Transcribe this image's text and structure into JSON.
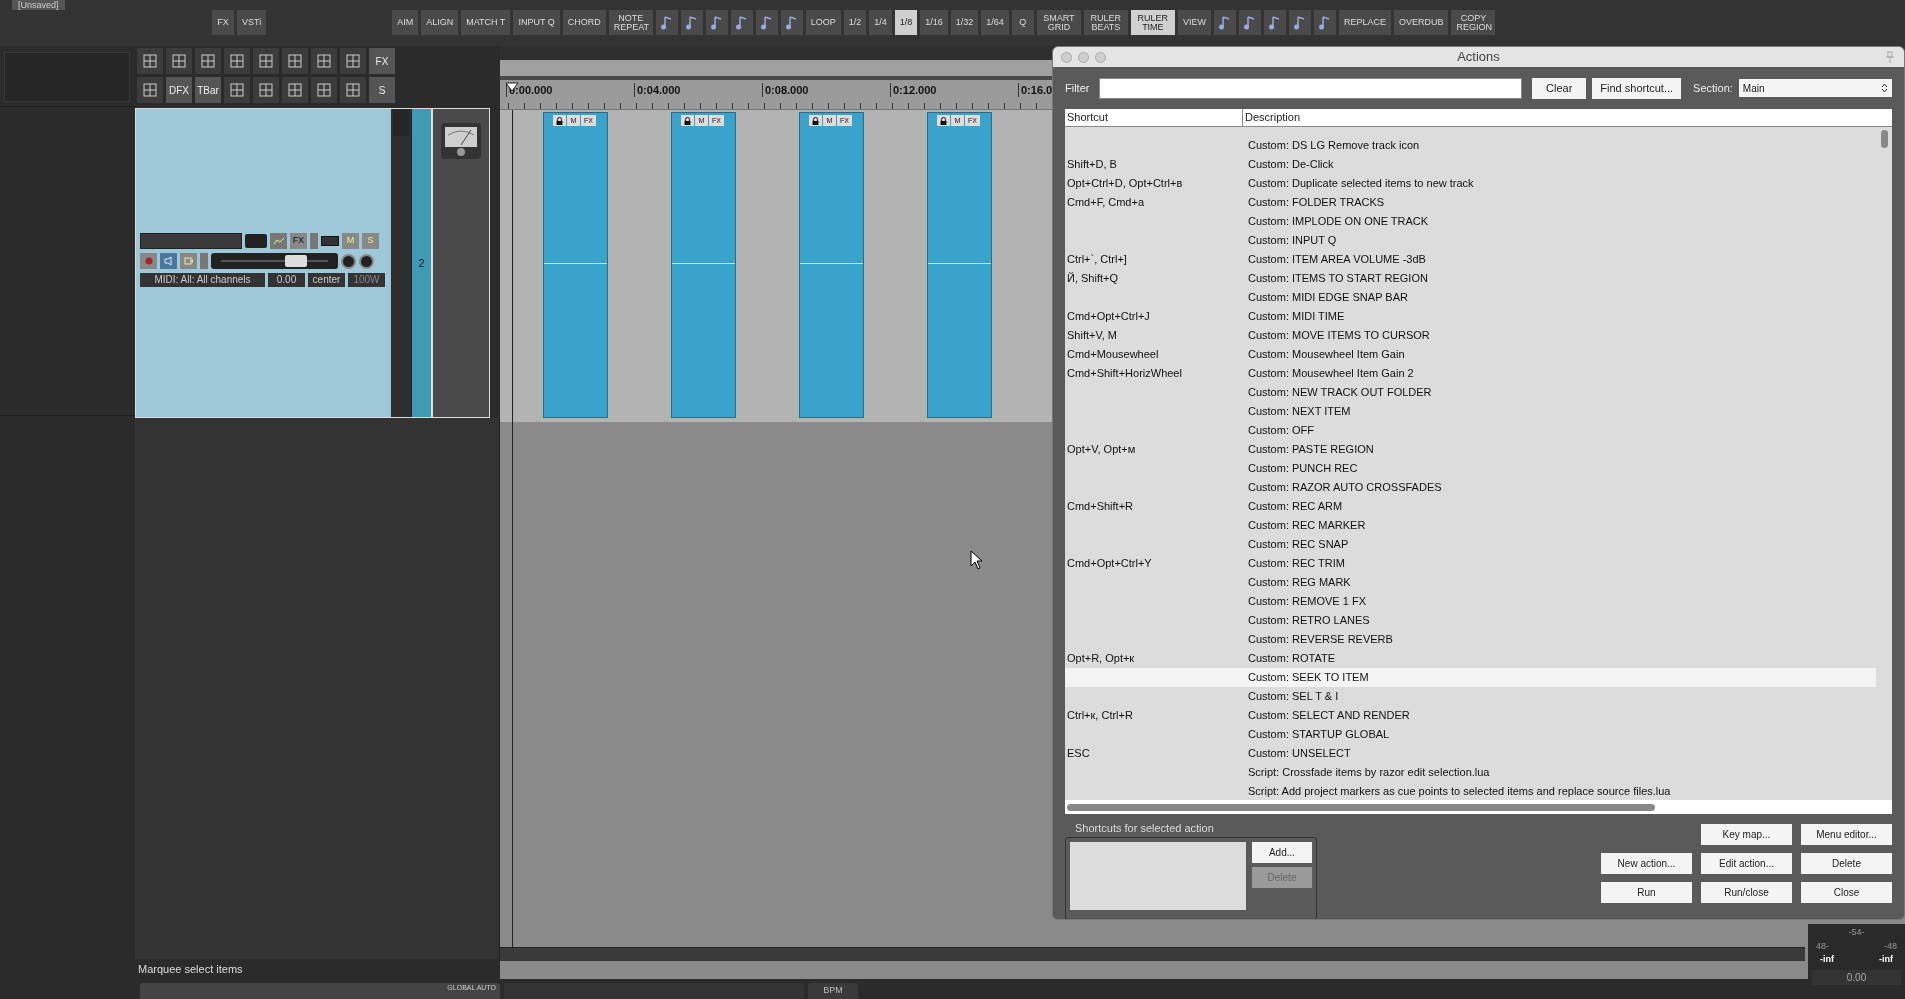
{
  "window": {
    "title": "[Unsaved]"
  },
  "toolbar": [
    {
      "kind": "text",
      "label": "FX",
      "selected": false
    },
    {
      "kind": "text",
      "label": "VSTi",
      "selected": false
    },
    {
      "kind": "gap"
    },
    {
      "kind": "text",
      "label": "AIM",
      "selected": false
    },
    {
      "kind": "text",
      "label": "ALIGN",
      "selected": false
    },
    {
      "kind": "text",
      "label": "MATCH T",
      "selected": false
    },
    {
      "kind": "text",
      "label": "INPUT Q",
      "selected": false
    },
    {
      "kind": "text",
      "label": "CHORD",
      "selected": false
    },
    {
      "kind": "text",
      "label": "NOTE REPEAT",
      "selected": false
    },
    {
      "kind": "icon"
    },
    {
      "kind": "icon"
    },
    {
      "kind": "icon"
    },
    {
      "kind": "icon"
    },
    {
      "kind": "icon"
    },
    {
      "kind": "icon"
    },
    {
      "kind": "text",
      "label": "LOOP",
      "selected": false
    },
    {
      "kind": "text",
      "label": "1/2",
      "selected": false
    },
    {
      "kind": "text",
      "label": "1/4",
      "selected": false
    },
    {
      "kind": "text",
      "label": "1/8",
      "selected": true
    },
    {
      "kind": "text",
      "label": "1/16",
      "selected": false
    },
    {
      "kind": "text",
      "label": "1/32",
      "selected": false
    },
    {
      "kind": "text",
      "label": "1/64",
      "selected": false
    },
    {
      "kind": "text",
      "label": "Q",
      "selected": false
    },
    {
      "kind": "text",
      "label": "SMART GRID",
      "selected": false
    },
    {
      "kind": "text",
      "label": "RULER BEATS",
      "selected": false
    },
    {
      "kind": "text",
      "label": "RULER TIME",
      "selected": true
    },
    {
      "kind": "text",
      "label": "VIEW",
      "selected": false
    },
    {
      "kind": "icon"
    },
    {
      "kind": "icon"
    },
    {
      "kind": "icon"
    },
    {
      "kind": "icon"
    },
    {
      "kind": "icon"
    },
    {
      "kind": "text",
      "label": "REPLACE",
      "selected": false
    },
    {
      "kind": "text",
      "label": "OVERDUB",
      "selected": false
    },
    {
      "kind": "text",
      "label": "COPY REGION",
      "selected": false
    }
  ],
  "palette": [
    [
      {
        "kind": "icon"
      },
      {
        "kind": "icon"
      },
      {
        "kind": "icon"
      },
      {
        "kind": "icon"
      },
      {
        "kind": "icon"
      },
      {
        "kind": "icon"
      },
      {
        "kind": "icon"
      },
      {
        "kind": "icon"
      },
      {
        "kind": "text",
        "label": "FX"
      }
    ],
    [
      {
        "kind": "icon"
      },
      {
        "kind": "text",
        "label": "DFX"
      },
      {
        "kind": "text",
        "label": "TBar"
      },
      {
        "kind": "icon"
      },
      {
        "kind": "icon"
      },
      {
        "kind": "icon"
      },
      {
        "kind": "icon"
      },
      {
        "kind": "icon"
      },
      {
        "kind": "text",
        "label": "S"
      }
    ]
  ],
  "track": {
    "number": "2",
    "fx": "FX",
    "mute": "M",
    "solo": "S",
    "input": "MIDI: All: All channels",
    "volume": "0.00",
    "pan": "center",
    "width": "100W",
    "fader": {
      "level": 0.7
    },
    "fx_bypass": {
      "on": true
    }
  },
  "ruler": {
    "labels": [
      "0:00.000",
      "0:04.000",
      "0:08.000",
      "0:12.000",
      "0:16.0"
    ]
  },
  "items": [
    {
      "lock": "M",
      "fx": "FX"
    },
    {
      "lock": "M",
      "fx": "FX"
    },
    {
      "lock": "M",
      "fx": "FX"
    },
    {
      "lock": "M",
      "fx": "FX"
    }
  ],
  "status_bar": {
    "text": "Marquee select items"
  },
  "transport": {
    "global_auto": "GLOBAL AUTO",
    "bpm": "BPM"
  },
  "meter": {
    "scale": [
      "-54-",
      "48-",
      "-48"
    ],
    "left": "-inf",
    "right": "-inf",
    "volume": "0.00"
  },
  "actions": {
    "title": "Actions",
    "filter_label": "Filter",
    "clear": "Clear",
    "find": "Find shortcut...",
    "section_label": "Section:",
    "section": "Main",
    "columns": [
      "Shortcut",
      "Description"
    ],
    "rows": [
      {
        "description": "Custom: DS LG Remove track icon",
        "selected": false
      },
      {
        "shortcut": "Shift+D, B",
        "description": "Custom: De-Click",
        "selected": false
      },
      {
        "shortcut": "Opt+Ctrl+D, Opt+Ctrl+в",
        "description": "Custom: Duplicate selected items to new track",
        "selected": false
      },
      {
        "shortcut": "Cmd+F, Cmd+a",
        "description": "Custom: FOLDER TRACKS",
        "selected": false
      },
      {
        "description": "Custom: IMPLODE ON ONE TRACK",
        "selected": false
      },
      {
        "description": "Custom: INPUT Q",
        "selected": false
      },
      {
        "shortcut": "Ctrl+`, Ctrl+]",
        "description": "Custom: ITEM AREA VOLUME -3dB",
        "selected": false
      },
      {
        "shortcut": "Й, Shift+Q",
        "description": "Custom: ITEMS TO START REGION",
        "selected": false
      },
      {
        "description": "Custom: MIDI EDGE SNAP BAR",
        "selected": false
      },
      {
        "shortcut": "Cmd+Opt+Ctrl+J",
        "description": "Custom: MIDI TIME",
        "selected": false
      },
      {
        "shortcut": "Shift+V, M",
        "description": "Custom: MOVE ITEMS TO CURSOR",
        "selected": false
      },
      {
        "shortcut": "Cmd+Mousewheel",
        "description": "Custom: Mousewheel Item Gain",
        "selected": false
      },
      {
        "shortcut": "Cmd+Shift+HorizWheel",
        "description": "Custom: Mousewheel Item Gain 2",
        "selected": false
      },
      {
        "description": "Custom: NEW TRACK OUT FOLDER",
        "selected": false
      },
      {
        "description": "Custom: NEXT ITEM",
        "selected": false
      },
      {
        "description": "Custom: OFF",
        "selected": false
      },
      {
        "shortcut": "Opt+V, Opt+м",
        "description": "Custom: PASTE REGION",
        "selected": false
      },
      {
        "description": "Custom: PUNCH REC",
        "selected": false
      },
      {
        "description": "Custom: RAZOR AUTO CROSSFADES",
        "selected": false
      },
      {
        "shortcut": "Cmd+Shift+R",
        "description": "Custom: REC ARM",
        "selected": false
      },
      {
        "description": "Custom: REC MARKER",
        "selected": false
      },
      {
        "description": "Custom: REC SNAP",
        "selected": false
      },
      {
        "shortcut": "Cmd+Opt+Ctrl+Y",
        "description": "Custom: REC TRIM",
        "selected": false
      },
      {
        "description": "Custom: REG MARK",
        "selected": false
      },
      {
        "description": "Custom: REMOVE 1 FX",
        "selected": false
      },
      {
        "description": "Custom: RETRO LANES",
        "selected": false
      },
      {
        "description": "Custom: REVERSE REVERB",
        "selected": false
      },
      {
        "shortcut": "Opt+R, Opt+к",
        "description": "Custom: ROTATE",
        "selected": false
      },
      {
        "description": "Custom: SEEK TO ITEM",
        "selected": true
      },
      {
        "description": "Custom: SEL T & I",
        "selected": false
      },
      {
        "shortcut": "Ctrl+к, Ctrl+R",
        "description": "Custom: SELECT AND RENDER",
        "selected": false
      },
      {
        "description": "Custom: STARTUP GLOBAL",
        "selected": false
      },
      {
        "shortcut": "ESC",
        "description": "Custom: UNSELECT",
        "selected": false
      },
      {
        "description": "Script: Crossfade items by razor edit selection.lua",
        "selected": false
      },
      {
        "description": "Script: Add project markers as cue points to selected items and replace source files.lua",
        "selected": false
      }
    ],
    "shortcuts_label": "Shortcuts for selected action",
    "add": "Add...",
    "delete_shortcut": {
      "label": "Delete",
      "disabled": true
    },
    "buttons": [
      [
        "Key map...",
        "Menu editor..."
      ],
      [
        "New action...",
        "Edit action...",
        "Delete"
      ],
      [
        "Run",
        "Run/close",
        "Close"
      ]
    ]
  }
}
